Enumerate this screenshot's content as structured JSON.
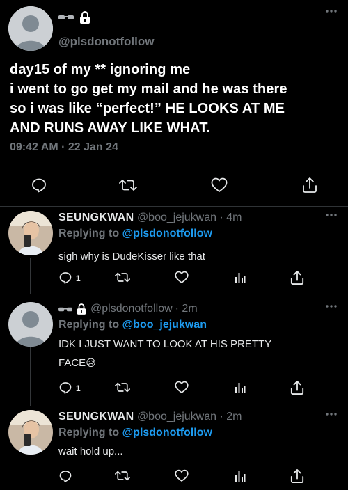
{
  "main_tweet": {
    "handle": "@plsdonotfollow",
    "text_lines": [
      "day15 of my ** ignoring me",
      "i went to go get my mail and he was there",
      "so i was like “perfect!” HE LOOKS AT ME",
      "AND RUNS AWAY LIKE WHAT."
    ],
    "timestamp": "09:42 AM · 22 Jan 24",
    "icons": [
      "reply-icon",
      "retweet-icon",
      "like-icon",
      "share-icon"
    ]
  },
  "replies": [
    {
      "name": "SEUNGKWAN",
      "handle": "@boo_jejukwan",
      "time": "· 4m",
      "replying_prefix": "Replying to",
      "replying_to": "@plsdonotfollow",
      "text": "sigh why is DudeKisser like that",
      "reply_count": "1"
    },
    {
      "name": "",
      "handle": "@plsdonotfollow",
      "time": "· 2m",
      "replying_prefix": "Replying to",
      "replying_to": "@boo_jejukwan",
      "text_line1": "IDK I JUST WANT TO LOOK AT HIS PRETTY",
      "text_line2": "FACE",
      "emoji": "😥",
      "reply_count": "1"
    },
    {
      "name": "SEUNGKWAN",
      "handle": "@boo_jejukwan",
      "time": "· 2m",
      "replying_prefix": "Replying to",
      "replying_to": "@plsdonotfollow",
      "text": "wait hold up...",
      "reply_count": ""
    }
  ],
  "colors": {
    "background": "#000000",
    "text": "#e7e9ea",
    "muted": "#71767b",
    "accent": "#1d9bf0",
    "divider": "#2f3336"
  }
}
